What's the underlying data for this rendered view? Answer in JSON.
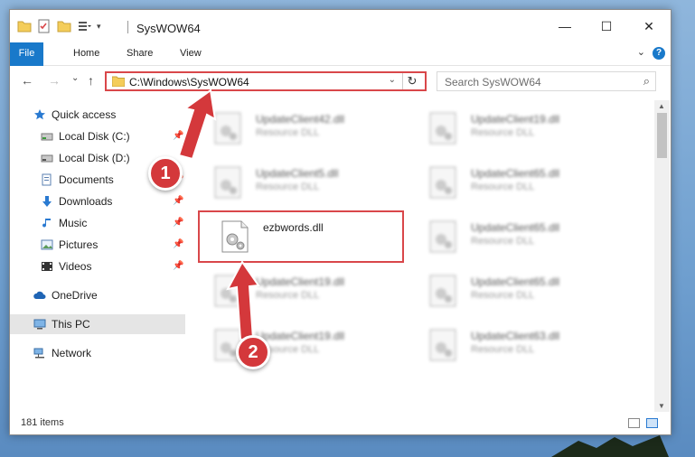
{
  "window": {
    "title": "SysWOW64",
    "minimize": "—",
    "maximize": "☐",
    "close": "✕"
  },
  "ribbon": {
    "tabs": [
      "File",
      "Home",
      "Share",
      "View"
    ],
    "help": "?"
  },
  "nav": {
    "back": "←",
    "forward": "→",
    "recent": "⌄",
    "up": "↑",
    "address": "C:\\Windows\\SysWOW64",
    "search_placeholder": "Search SysWOW64"
  },
  "sidebar": {
    "items": [
      {
        "label": "Quick access",
        "icon": "star-icon",
        "pinned": false
      },
      {
        "label": "Local Disk (C:)",
        "icon": "drive-icon",
        "pinned": true
      },
      {
        "label": "Local Disk (D:)",
        "icon": "drive-icon",
        "pinned": false
      },
      {
        "label": "Documents",
        "icon": "documents-icon",
        "pinned": true
      },
      {
        "label": "Downloads",
        "icon": "download-icon",
        "pinned": true
      },
      {
        "label": "Music",
        "icon": "music-icon",
        "pinned": true
      },
      {
        "label": "Pictures",
        "icon": "pictures-icon",
        "pinned": true
      },
      {
        "label": "Videos",
        "icon": "videos-icon",
        "pinned": true
      },
      {
        "label": "OneDrive",
        "icon": "cloud-icon",
        "pinned": false
      },
      {
        "label": "This PC",
        "icon": "computer-icon",
        "pinned": false,
        "selected": true
      },
      {
        "label": "Network",
        "icon": "network-icon",
        "pinned": false
      }
    ]
  },
  "files": {
    "left": [
      {
        "name": "UpdateClient42.dll",
        "type": "Resource DLL"
      },
      {
        "name": "UpdateClient5.dll",
        "type": "Resource DLL"
      },
      {
        "name": "ezbwords.dll",
        "type": ""
      },
      {
        "name": "UpdateClient19.dll",
        "type": "Resource DLL"
      },
      {
        "name": "UpdateClient19.dll",
        "type": "Resource DLL"
      }
    ],
    "right": [
      {
        "name": "UpdateClient19.dll",
        "type": "Resource DLL"
      },
      {
        "name": "UpdateClient65.dll",
        "type": "Resource DLL"
      },
      {
        "name": "UpdateClient65.dll",
        "type": "Resource DLL"
      },
      {
        "name": "UpdateClient65.dll",
        "type": "Resource DLL"
      },
      {
        "name": "UpdateClient63.dll",
        "type": "Resource DLL"
      }
    ]
  },
  "status": {
    "count": "181 items"
  },
  "annotations": {
    "step1": "1",
    "step2": "2",
    "color": "#d4383b"
  }
}
